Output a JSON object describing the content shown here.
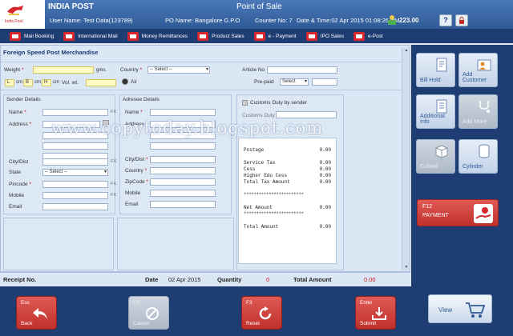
{
  "header": {
    "app_title": "INDIA POST",
    "pos_title": "Point of Sale",
    "user_name": "User Name: Test Data(123789)",
    "po_name": "PO Name: Bangalore G.P.O",
    "counter_no": "Counter No: 7",
    "date_time": "Date & Time:02 Apr 2015  01:08:26 PM",
    "balance": "223.00",
    "help_label": "?",
    "logo_caption": "India Post"
  },
  "menu": [
    {
      "label": "Mail Booking"
    },
    {
      "label": "International Mail"
    },
    {
      "label": "Money Remittances"
    },
    {
      "label": "Product Sales"
    },
    {
      "label": "e - Payment"
    },
    {
      "label": "IPO Sales"
    },
    {
      "label": "e-Post"
    }
  ],
  "form": {
    "title": "Foreign Speed Post Merchandise",
    "weight_label": "Weight",
    "weight_unit": "gms.",
    "dim_l": "L",
    "dim_b": "B",
    "dim_h": "H",
    "dim_unit": "cm",
    "vol_wt_label": "Vol. wt.",
    "country_label": "Country",
    "country_value": "-- Select --",
    "air_label": "Air",
    "article_no_label": "Article No",
    "prepaid_label": "Pre-paid",
    "prepaid_value": "Select",
    "customs_checkbox_label": "Customs Duty by sender",
    "customs_duty_label": "Customs Duty",
    "required_mark": "*",
    "fx_label": "FX",
    "sender": {
      "title": "Sender Details",
      "name": "Name",
      "address": "Address",
      "city": "City/Dist",
      "state": "State",
      "state_value": "-- Select --",
      "pincode": "Pincode",
      "mobile": "Mobile",
      "email": "Email"
    },
    "addressee": {
      "title": "Adresee Details",
      "name": "Name",
      "address": "Address",
      "city": "City/Dist",
      "country": "Country",
      "zipcode": "ZipCode",
      "mobile": "Mobile",
      "email": "Email"
    }
  },
  "receipt": {
    "postage_label": "Postage",
    "postage_value": "0.00",
    "service_tax_label": "Service Tax",
    "service_tax_value": "0.00",
    "cess_label": "Cess",
    "cess_value": "0.00",
    "higher_cess_label": "Higher Edu Cess",
    "higher_cess_value": "0.00",
    "total_tax_label": "Total Tax Amount",
    "total_tax_value": "0.00",
    "separator": "************************",
    "net_label": "Net Amount",
    "net_value": "0.00",
    "total_label": "Total Amount",
    "total_value": "0.00"
  },
  "status": {
    "receipt_label": "Receipt No.",
    "date_label": "Date",
    "date_value": "02 Apr 2015",
    "quantity_label": "Quantity",
    "quantity_value": "0",
    "total_label": "Total Amount",
    "total_value": "0.00"
  },
  "actions": [
    {
      "key": "Esc",
      "label": "Back",
      "enabled": true
    },
    {
      "key": "F2",
      "label": "Cancel",
      "enabled": false
    },
    {
      "key": "F3",
      "label": "Reset",
      "enabled": true
    },
    {
      "key": "Enter",
      "label": "Submit",
      "enabled": true
    }
  ],
  "tiles": [
    {
      "label": "Bill Hold",
      "enabled": true
    },
    {
      "label": "Add Customer",
      "enabled": true
    },
    {
      "label": "Additional Info",
      "enabled": true
    },
    {
      "label": "Add More",
      "enabled": false
    },
    {
      "label": "Cuboid",
      "enabled": false
    },
    {
      "label": "Cylinder",
      "enabled": true
    }
  ],
  "payment": {
    "key": "F12",
    "label": "PAYMENT"
  },
  "view": {
    "label": "View"
  },
  "watermark": "www.copytoday.blogspot.com",
  "colors": {
    "header": "#2f5a97",
    "nav": "#1e3d73",
    "accent_red": "#c0302b",
    "panel": "#dbe7f4",
    "amount_red": "#d01818"
  }
}
